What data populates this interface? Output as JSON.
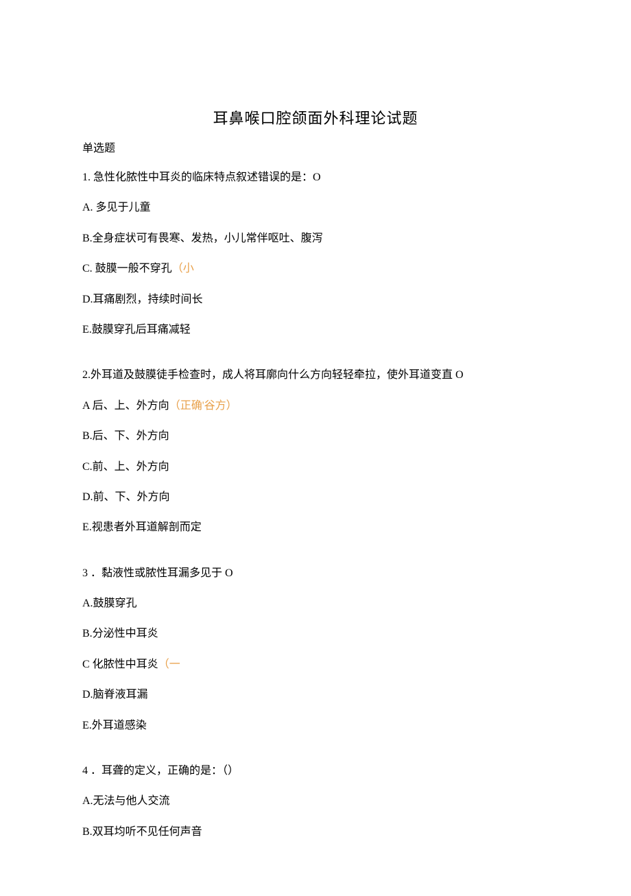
{
  "title": "耳鼻喉口腔颌面外科理论试题",
  "section_label": "单选题",
  "questions": [
    {
      "stem": "1. 急性化脓性中耳炎的临床特点叙述错误的是：O",
      "options": [
        {
          "text": "A. 多见于儿童",
          "annot": ""
        },
        {
          "text": "B.全身症状可有畏寒、发热，小儿常伴呕吐、腹泻",
          "annot": ""
        },
        {
          "text": "C. 鼓膜一般不穿孔",
          "annot": "（小"
        },
        {
          "text": "D.耳痛剧烈，持续时间长",
          "annot": ""
        },
        {
          "text": "E.鼓膜穿孔后耳痛减轻",
          "annot": ""
        }
      ]
    },
    {
      "stem": "2.外耳道及鼓膜徒手检查时，成人将耳廓向什么方向轻轻牵拉，使外耳道变直 O",
      "options": [
        {
          "text": "A 后、上、外方向",
          "annot": "（正确'谷方）"
        },
        {
          "text": "B.后、下、外方向",
          "annot": ""
        },
        {
          "text": "C.前、上、外方向",
          "annot": ""
        },
        {
          "text": "D.前、下、外方向",
          "annot": ""
        },
        {
          "text": "E.视患者外耳道解剖而定",
          "annot": ""
        }
      ]
    },
    {
      "stem": "3 ．黏液性或脓性耳漏多见于 O",
      "options": [
        {
          "text": "A.鼓膜穿孔",
          "annot": ""
        },
        {
          "text": "B.分泌性中耳炎",
          "annot": ""
        },
        {
          "text": "C 化脓性中耳炎",
          "annot": "（一"
        },
        {
          "text": "D.脑脊液耳漏",
          "annot": ""
        },
        {
          "text": "E.外耳道感染",
          "annot": ""
        }
      ]
    },
    {
      "stem": "4 ．耳聋的定义，正确的是：（）",
      "options": [
        {
          "text": "A.无法与他人交流",
          "annot": ""
        },
        {
          "text": "B.双耳均听不见任何声音",
          "annot": ""
        }
      ]
    }
  ]
}
